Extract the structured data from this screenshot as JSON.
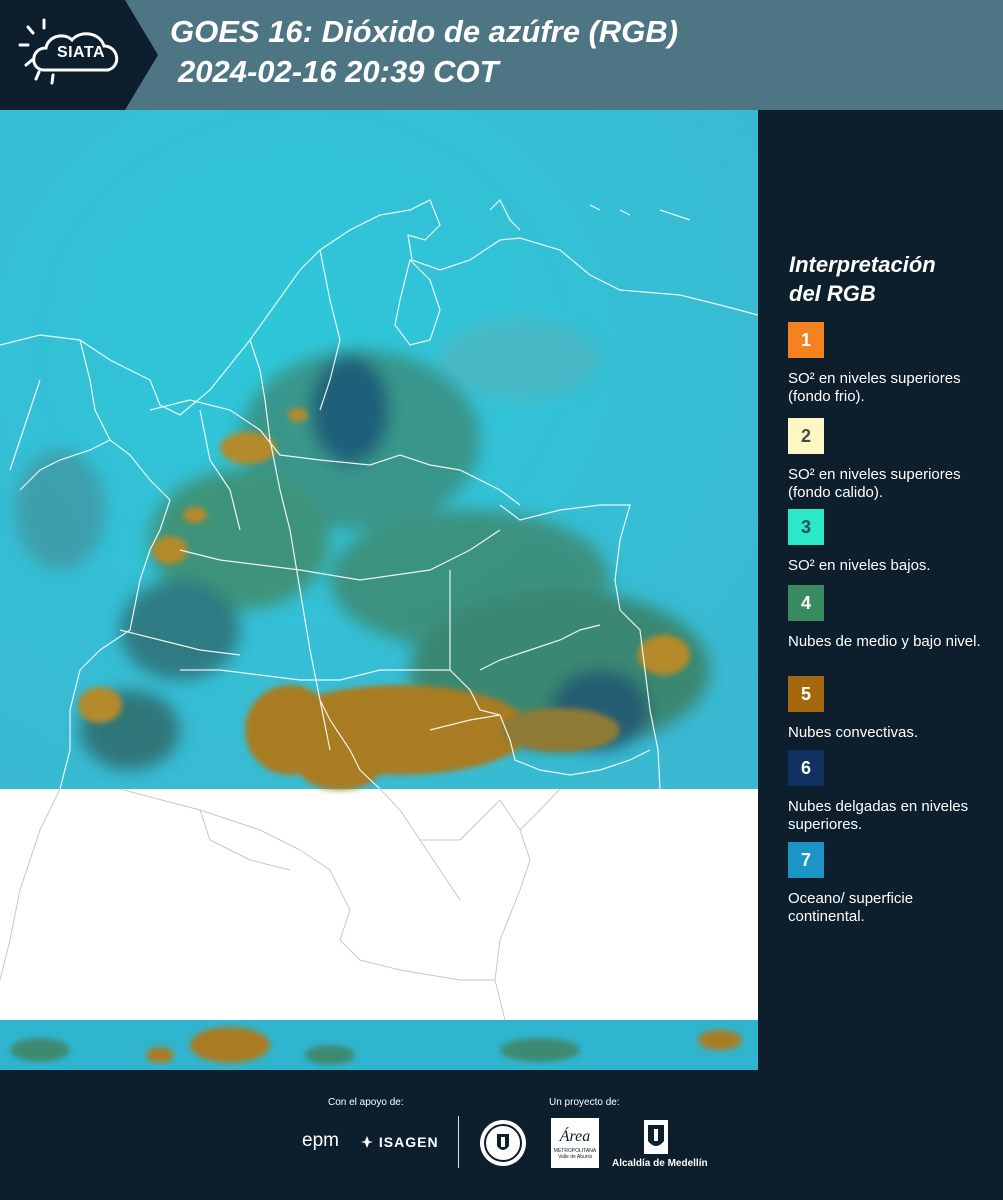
{
  "header": {
    "logo_text": "SIATA",
    "title_line1": "GOES 16: Dióxido de azúfre (RGB)",
    "title_line2": "2024-02-16 20:39 COT"
  },
  "legend": {
    "title_line1": "Interpretación",
    "title_line2": "del RGB",
    "items": [
      {
        "number": "1",
        "color": "#f58220",
        "text_color": "#ffffff",
        "description": "SO² en niveles superiores (fondo frio)."
      },
      {
        "number": "2",
        "color": "#fdf7c3",
        "text_color": "#4a4a4a",
        "description": "SO² en niveles superiores (fondo calido)."
      },
      {
        "number": "3",
        "color": "#2ae8c8",
        "text_color": "#2d4f5a",
        "description": "SO² en niveles bajos."
      },
      {
        "number": "4",
        "color": "#3a8a5f",
        "text_color": "#ffffff",
        "description": "Nubes de medio y bajo nivel."
      },
      {
        "number": "5",
        "color": "#a5680f",
        "text_color": "#ffffff",
        "description": "Nubes convectivas."
      },
      {
        "number": "6",
        "color": "#0f3263",
        "text_color": "#ffffff",
        "description": "Nubes delgadas en niveles superiores."
      },
      {
        "number": "7",
        "color": "#1b94c6",
        "text_color": "#ffffff",
        "description": "Oceano/ superficie continental."
      }
    ]
  },
  "footer": {
    "support_label": "Con el apoyo de:",
    "project_label": "Un proyecto de:",
    "sponsor_epm": "epm",
    "sponsor_isagen": "ISAGEN",
    "sponsor_area_title": "Área",
    "sponsor_area_subtitle": "METROPOLITANA",
    "sponsor_area_sub2": "Valle de Aburrá",
    "sponsor_alcaldia": "Alcaldía de Medellín"
  }
}
